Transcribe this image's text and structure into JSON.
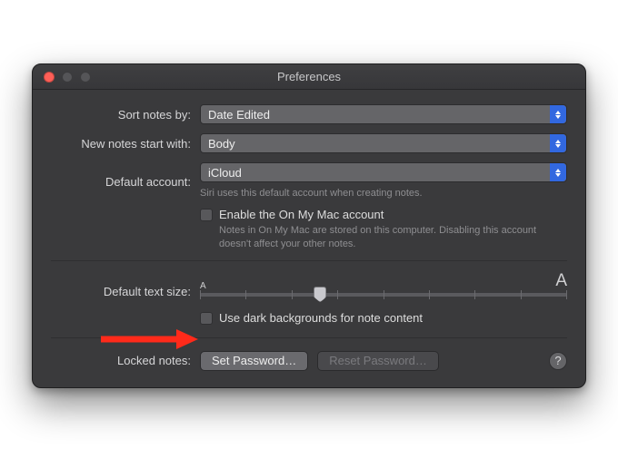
{
  "window": {
    "title": "Preferences"
  },
  "sort_notes": {
    "label": "Sort notes by:",
    "value": "Date Edited"
  },
  "new_notes": {
    "label": "New notes start with:",
    "value": "Body"
  },
  "default_account": {
    "label": "Default account:",
    "value": "iCloud",
    "hint": "Siri uses this default account when creating notes."
  },
  "on_my_mac": {
    "label": "Enable the On My Mac account",
    "hint": "Notes in On My Mac are stored on this computer. Disabling this account doesn't affect your other notes."
  },
  "text_size": {
    "label": "Default text size:",
    "small": "A",
    "large": "A"
  },
  "dark_bg": {
    "label": "Use dark backgrounds for note content"
  },
  "locked_notes": {
    "label": "Locked notes:",
    "set": "Set Password…",
    "reset": "Reset Password…"
  },
  "help": {
    "symbol": "?"
  },
  "colors": {
    "accent": "#3268e0",
    "window_bg": "#3a3a3c"
  }
}
